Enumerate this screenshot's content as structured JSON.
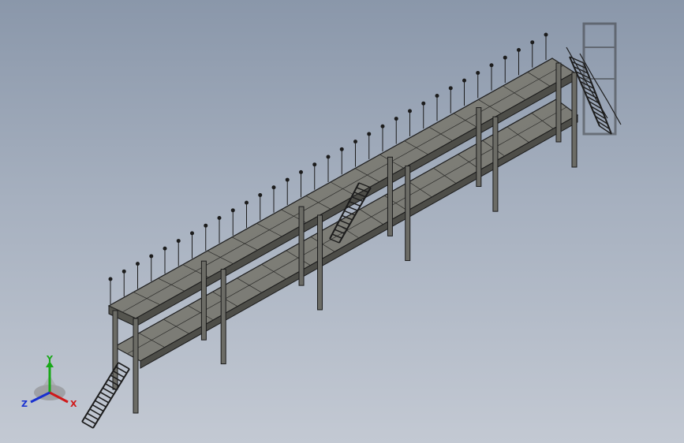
{
  "view": {
    "background_top": "#8a97aa",
    "background_bottom": "#c3c9d3",
    "model_color": "#7a7a74",
    "edge_color": "#1c1c1c"
  },
  "triad": {
    "x_label": "X",
    "y_label": "Y",
    "z_label": "Z",
    "x_color": "#d01818",
    "y_color": "#18a818",
    "z_color": "#1830d0",
    "icon": "orientation-triad-icon"
  }
}
